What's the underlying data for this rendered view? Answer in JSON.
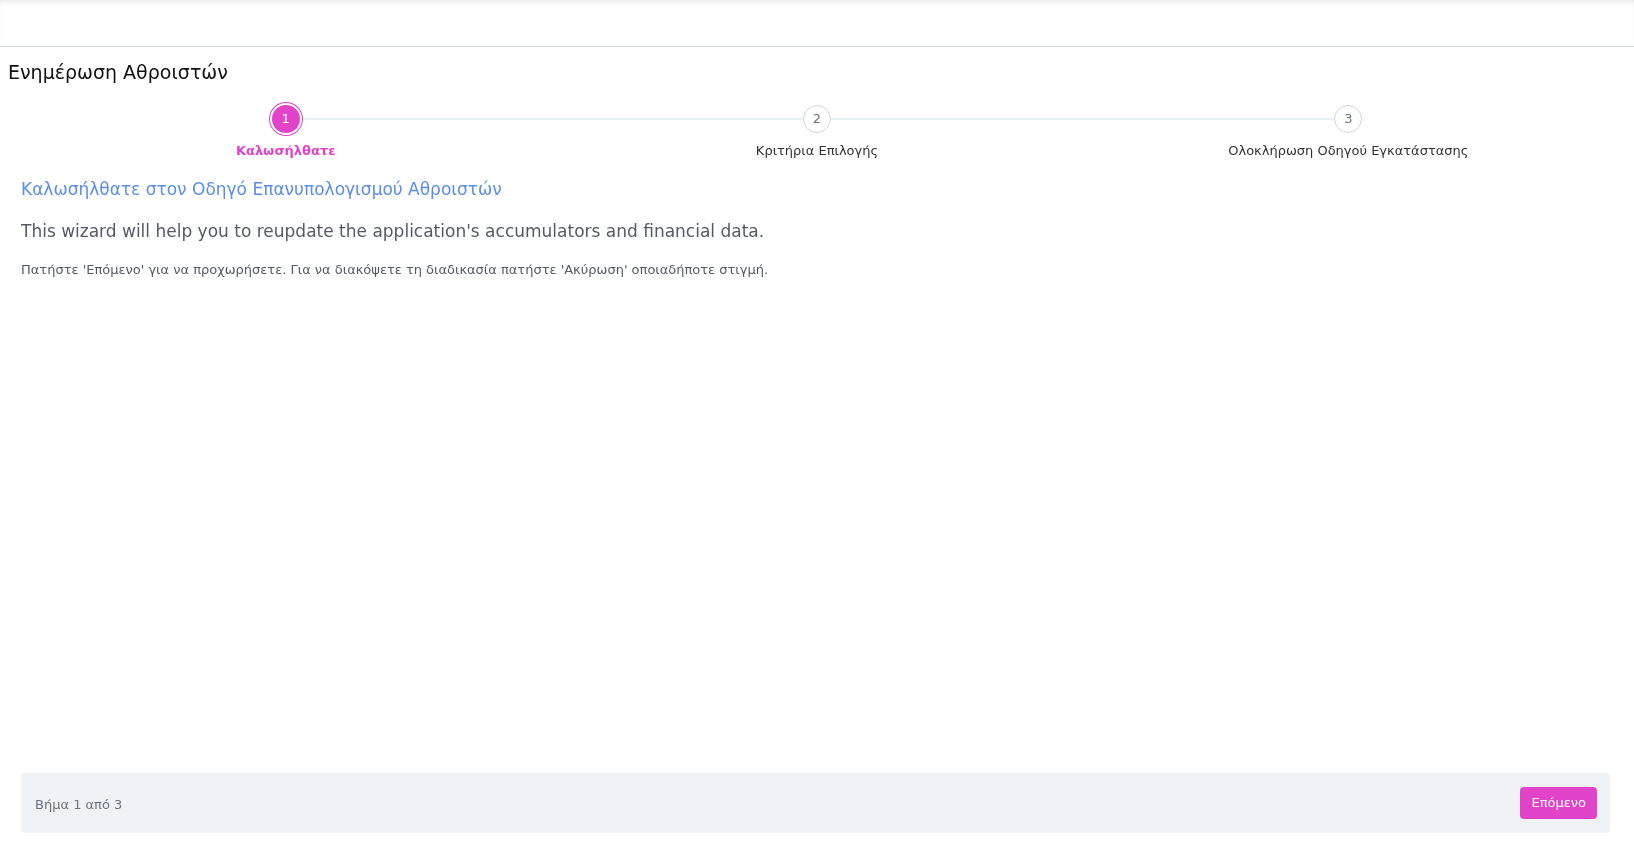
{
  "page_title": "Ενημέρωση Αθροιστών",
  "steps": [
    {
      "number": "1",
      "label": "Καλωσήλθατε",
      "selected": true
    },
    {
      "number": "2",
      "label": "Κριτήρια Επιλογής",
      "selected": false
    },
    {
      "number": "3",
      "label": "Ολοκλήρωση Οδηγού Εγκατάστασης",
      "selected": false
    }
  ],
  "heading": "Καλωσήλθατε στον Οδηγό Επανυπολογισμού Αθροιστών",
  "intro": "This wizard will help you to reupdate the application's accumulators and financial data.",
  "instructions": "Πατήστε 'Επόμενο' για να προχωρήσετε. Για να διακόψετε τη διαδικασία πατήστε 'Ακύρωση' οποιαδήποτε στιγμή.",
  "footer": {
    "step_text": "Βήμα 1 από 3",
    "next_button": "Επόμενο"
  }
}
